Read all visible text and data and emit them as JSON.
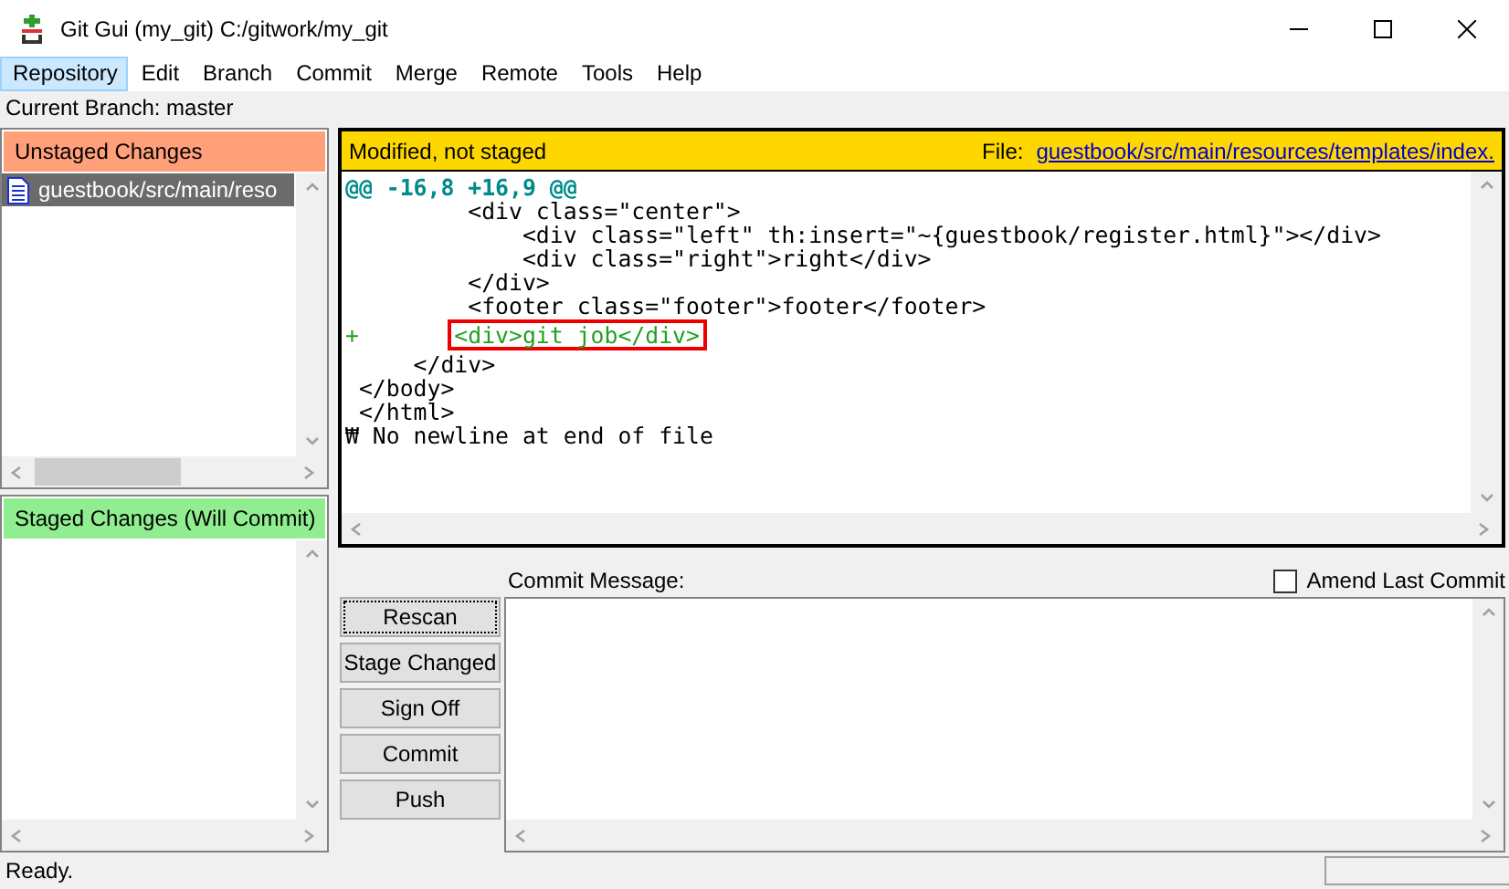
{
  "window": {
    "title": "Git Gui (my_git) C:/gitwork/my_git"
  },
  "menu": [
    {
      "label": "Repository",
      "selected": true
    },
    {
      "label": "Edit",
      "selected": false
    },
    {
      "label": "Branch",
      "selected": false
    },
    {
      "label": "Commit",
      "selected": false
    },
    {
      "label": "Merge",
      "selected": false
    },
    {
      "label": "Remote",
      "selected": false
    },
    {
      "label": "Tools",
      "selected": false
    },
    {
      "label": "Help",
      "selected": false
    }
  ],
  "current_branch": "Current Branch: master",
  "unstaged": {
    "title": "Unstaged Changes",
    "files": [
      {
        "name": "guestbook/src/main/reso",
        "selected": true
      }
    ]
  },
  "staged": {
    "title": "Staged Changes (Will Commit)"
  },
  "diff": {
    "status": "Modified, not staged",
    "file_label": "File:",
    "file_path": "guestbook/src/main/resources/templates/index.",
    "lines": [
      {
        "kind": "hunk",
        "text": "@@ -16,8 +16,9 @@",
        "highlighted": false
      },
      {
        "kind": "context",
        "text": "         <div class=\"center\">",
        "highlighted": false
      },
      {
        "kind": "context",
        "text": "             <div class=\"left\" th:insert=\"~{guestbook/register.html}\"></div>",
        "highlighted": false
      },
      {
        "kind": "context",
        "text": "             <div class=\"right\">right</div>",
        "highlighted": false
      },
      {
        "kind": "context",
        "text": "         </div>",
        "highlighted": false
      },
      {
        "kind": "context",
        "text": "         <footer class=\"footer\">footer</footer>",
        "highlighted": false
      },
      {
        "kind": "added",
        "text": "<div>git job</div>",
        "prefix": "+",
        "highlighted": true
      },
      {
        "kind": "context",
        "text": "     </div>",
        "highlighted": false
      },
      {
        "kind": "context",
        "text": " </body>",
        "highlighted": false
      },
      {
        "kind": "context",
        "text": " </html>",
        "highlighted": false
      },
      {
        "kind": "note",
        "text": "₩ No newline at end of file",
        "highlighted": false
      }
    ]
  },
  "buttons": [
    {
      "label": "Rescan",
      "focused": true
    },
    {
      "label": "Stage Changed",
      "focused": false
    },
    {
      "label": "Sign Off",
      "focused": false
    },
    {
      "label": "Commit",
      "focused": false
    },
    {
      "label": "Push",
      "focused": false
    }
  ],
  "commit_message": {
    "label": "Commit Message:"
  },
  "amend": {
    "label": "Amend Last Commit",
    "checked": false
  },
  "status_bar": {
    "text": "Ready."
  }
}
